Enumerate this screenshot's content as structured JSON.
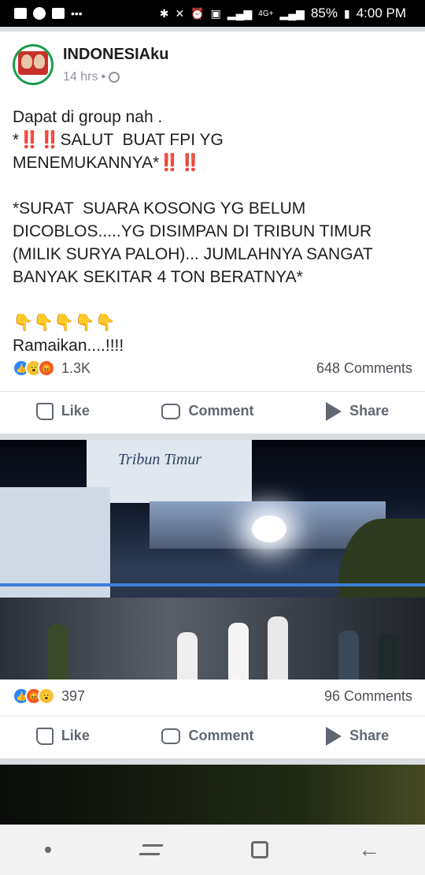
{
  "status_bar": {
    "battery": "85%",
    "time": "4:00 PM",
    "network": "4G+"
  },
  "post1": {
    "page_name": "INDONESIAku",
    "time_ago": "14 hrs",
    "separator": "•",
    "text_line1": "Dapat di group nah .",
    "text_line2_pre": "*",
    "text_line2_mid": "SALUT  BUAT FPI YG",
    "text_line3": "MENEMUKANNYA*",
    "text_para2": "*SURAT  SUARA KOSONG YG BELUM DICOBLOS.....YG DISIMPAN DI TRIBUN TIMUR (MILIK SURYA PALOH)... JUMLAHNYA SANGAT BANYAK SEKITAR 4 TON BERATNYA*",
    "bang": "‼️‼️",
    "hands": "👇👇👇👇👇",
    "closing": "Ramaikan....!!!!",
    "reaction_count": "1.3K",
    "comments": "648 Comments"
  },
  "post2": {
    "video_sign": "Tribun Timur",
    "reaction_count": "397",
    "comments": "96 Comments"
  },
  "actions": {
    "like": "Like",
    "comment": "Comment",
    "share": "Share"
  },
  "colors": {
    "reaction_like": "#2d88ff",
    "reaction_wow": "#f7c13c",
    "reaction_angry": "#f15a24",
    "fence": "#3d7dd8"
  }
}
